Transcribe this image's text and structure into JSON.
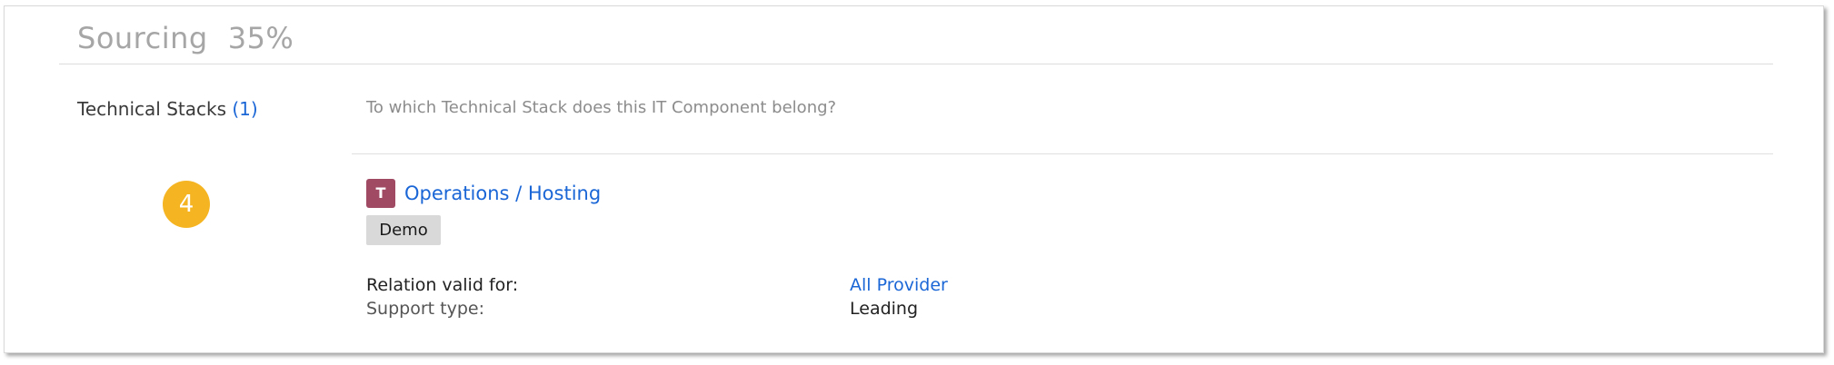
{
  "section": {
    "title": "Sourcing",
    "percent": "35%"
  },
  "technical_stacks": {
    "label": "Technical Stacks",
    "count": "(1)",
    "question": "To which Technical Stack does this IT Component belong?"
  },
  "step_badge": "4",
  "relation": {
    "type_icon": "T",
    "type_icon_color": "#a04a64",
    "name": "Operations / Hosting",
    "tag": "Demo",
    "fields": [
      {
        "label": "Relation valid for:",
        "value": "All Provider"
      },
      {
        "label": "Support type:",
        "value": "Leading"
      }
    ]
  },
  "colors": {
    "link": "#1a66d6",
    "badge": "#f5b523",
    "tag_bg": "#d9d9d9"
  }
}
